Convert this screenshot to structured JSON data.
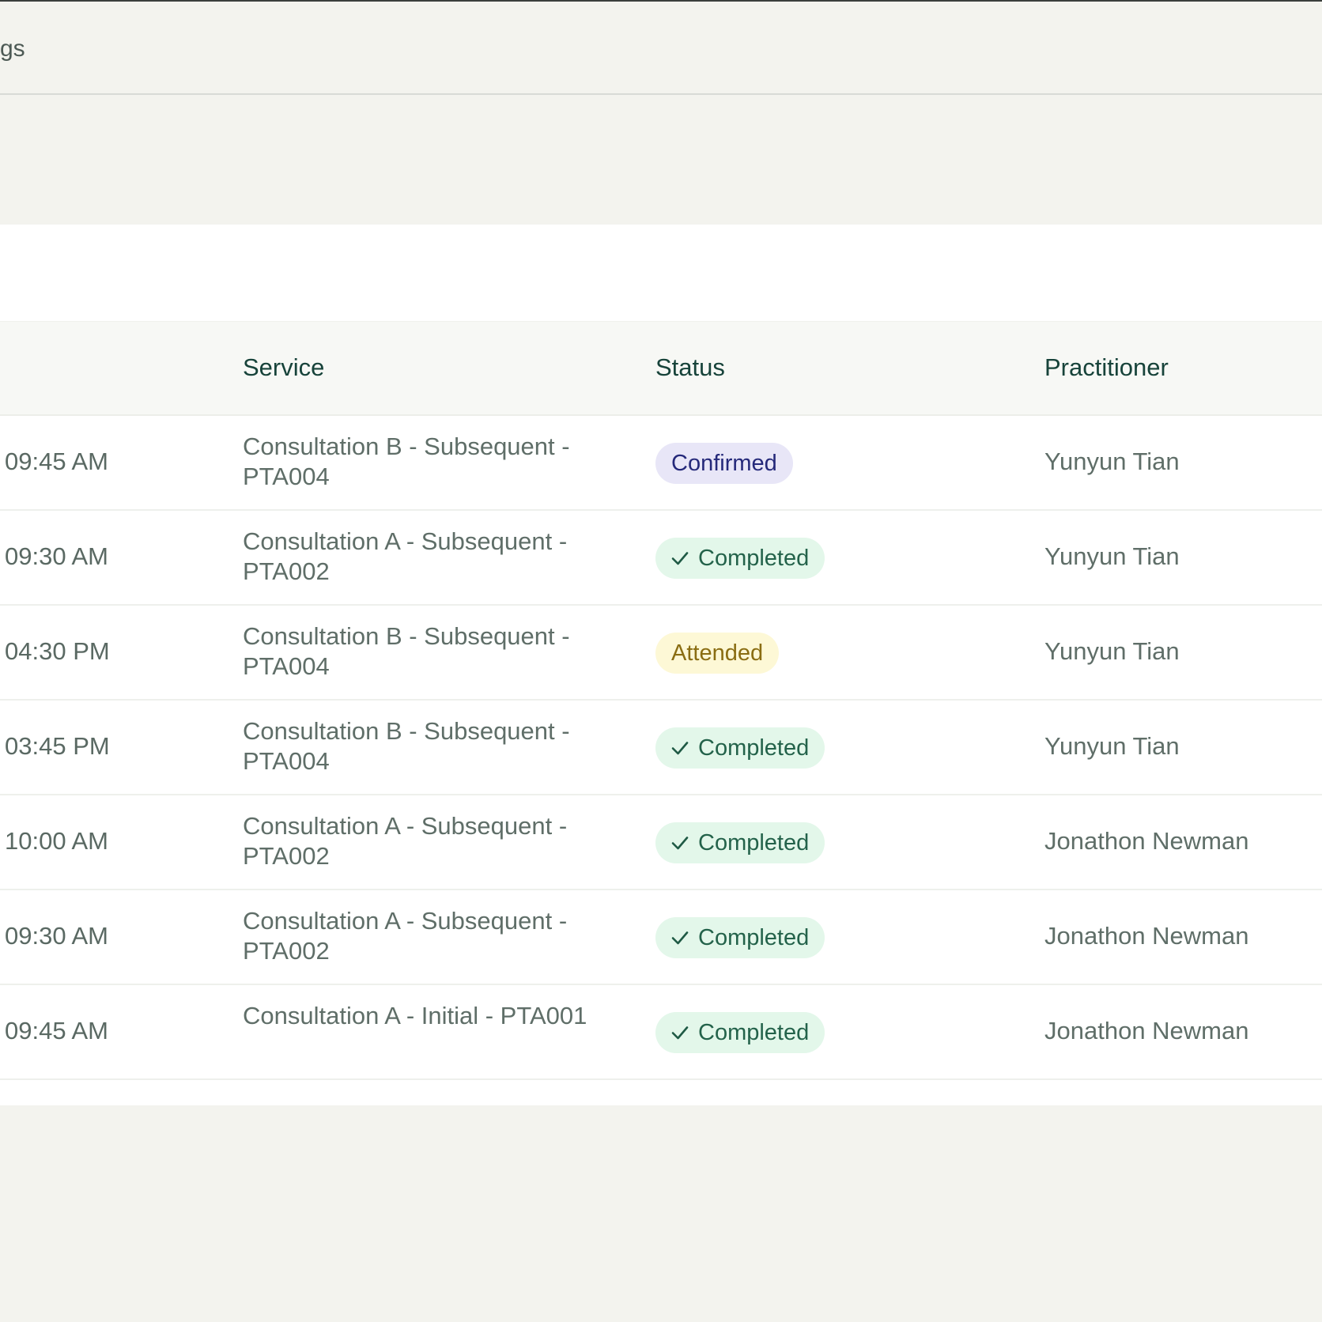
{
  "header": {
    "title_fragment": "gs"
  },
  "table": {
    "columns": {
      "time": "",
      "service": "Service",
      "status": "Status",
      "practitioner": "Practitioner"
    },
    "rows": [
      {
        "time": "09:45 AM",
        "service": "Consultation B - Subsequent - PTA004",
        "status": "Confirmed",
        "status_type": "confirmed",
        "practitioner": "Yunyun Tian"
      },
      {
        "time": "09:30 AM",
        "service": "Consultation A - Subsequent - PTA002",
        "status": "Completed",
        "status_type": "completed",
        "practitioner": "Yunyun Tian"
      },
      {
        "time": "04:30 PM",
        "service": "Consultation B - Subsequent - PTA004",
        "status": "Attended",
        "status_type": "attended",
        "practitioner": "Yunyun Tian"
      },
      {
        "time": "03:45 PM",
        "service": "Consultation B - Subsequent - PTA004",
        "status": "Completed",
        "status_type": "completed",
        "practitioner": "Yunyun Tian"
      },
      {
        "time": "10:00 AM",
        "service": "Consultation A - Subsequent - PTA002",
        "status": "Completed",
        "status_type": "completed",
        "practitioner": "Jonathon Newman"
      },
      {
        "time": "09:30 AM",
        "service": "Consultation A - Subsequent - PTA002",
        "status": "Completed",
        "status_type": "completed",
        "practitioner": "Jonathon Newman"
      },
      {
        "time": "09:45 AM",
        "service": "Consultation A - Initial - PTA001",
        "status": "Completed",
        "status_type": "completed",
        "practitioner": "Jonathon Newman"
      }
    ]
  },
  "icons": {
    "completed_badge": "checkmark-icon"
  },
  "colors": {
    "confirmed_bg": "#e8e6f7",
    "confirmed_text": "#25297a",
    "completed_bg": "#e3f7ea",
    "completed_text": "#23624a",
    "attended_bg": "#fdf8d6",
    "attended_text": "#8a6d12",
    "header_text": "#17433a"
  }
}
